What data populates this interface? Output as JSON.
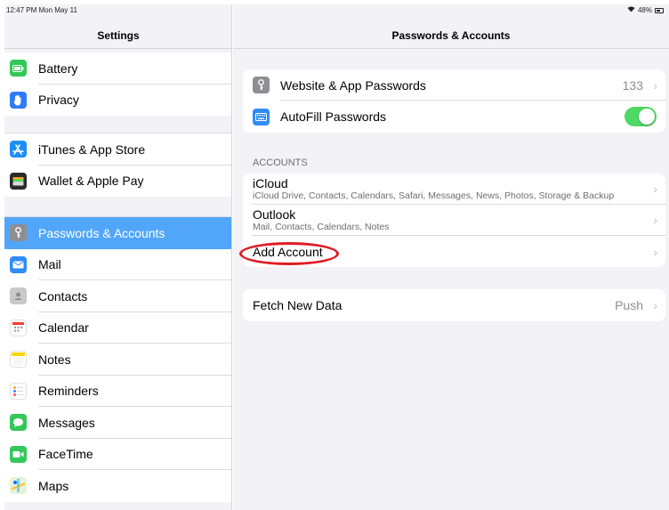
{
  "status": {
    "time_date": "12:47 PM  Mon May 11",
    "battery": "48%"
  },
  "sidebar": {
    "title": "Settings",
    "group1": [
      {
        "label": "Battery",
        "icon": "battery-icon",
        "color": "#34c759"
      },
      {
        "label": "Privacy",
        "icon": "hand-icon",
        "color": "#2f7cf6"
      }
    ],
    "group2": [
      {
        "label": "iTunes & App Store",
        "icon": "app-store-icon",
        "color": "#1e8ff2"
      },
      {
        "label": "Wallet & Apple Pay",
        "icon": "wallet-icon",
        "color": "#2b2b2b"
      }
    ],
    "group3": [
      {
        "label": "Passwords & Accounts",
        "icon": "key-icon",
        "color": "#8e8e93",
        "active": true
      },
      {
        "label": "Mail",
        "icon": "mail-icon",
        "color": "#2f8cf5"
      },
      {
        "label": "Contacts",
        "icon": "contacts-icon",
        "color": "#b3b3b3"
      },
      {
        "label": "Calendar",
        "icon": "calendar-icon",
        "color": "#ffffff"
      },
      {
        "label": "Notes",
        "icon": "notes-icon",
        "color": "#ffd60a"
      },
      {
        "label": "Reminders",
        "icon": "reminders-icon",
        "color": "#ffffff"
      },
      {
        "label": "Messages",
        "icon": "messages-icon",
        "color": "#34c759"
      },
      {
        "label": "FaceTime",
        "icon": "facetime-icon",
        "color": "#34c759"
      },
      {
        "label": "Maps",
        "icon": "maps-icon",
        "color": "#5ac8fa"
      }
    ]
  },
  "detail": {
    "title": "Passwords & Accounts",
    "passwords": {
      "website_label": "Website & App Passwords",
      "website_count": "133",
      "autofill_label": "AutoFill Passwords",
      "autofill_on": true
    },
    "accounts_header": "ACCOUNTS",
    "accounts": [
      {
        "name": "iCloud",
        "detail": "iCloud Drive, Contacts, Calendars, Safari, Messages, News, Photos, Storage & Backup"
      },
      {
        "name": "Outlook",
        "detail": "Mail, Contacts, Calendars, Notes"
      }
    ],
    "add_account": "Add Account",
    "fetch": {
      "label": "Fetch New Data",
      "value": "Push"
    }
  },
  "colors": {
    "accent": "#52a6f9",
    "toggle_on": "#4cd964",
    "highlight": "#e01b24"
  }
}
